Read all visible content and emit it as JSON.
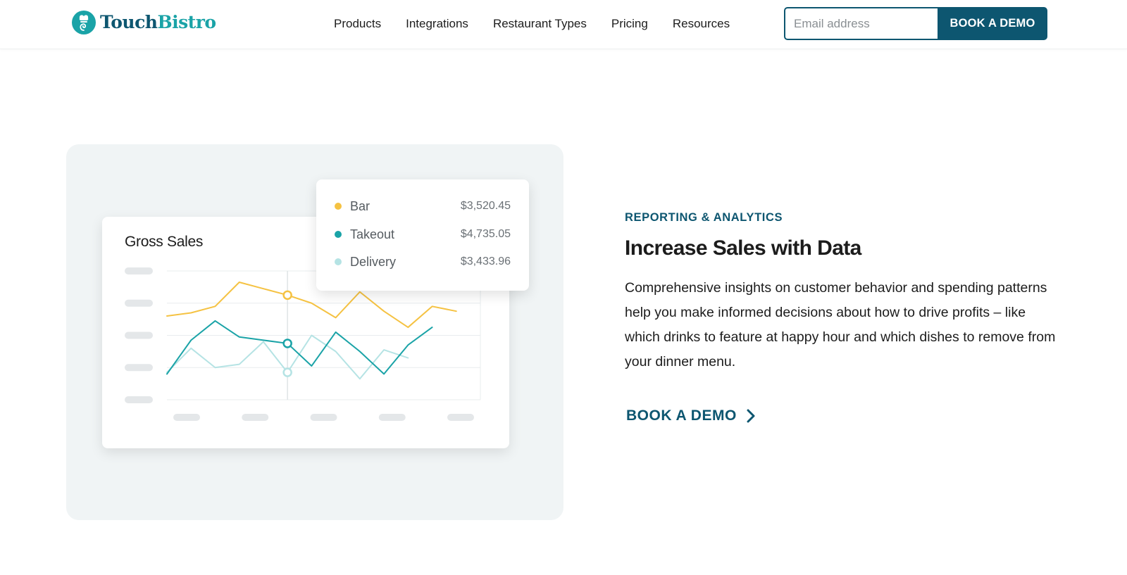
{
  "brand": {
    "name_part1": "Touch",
    "name_part2": "Bistro",
    "logo_icon": "chef-hat-swirl-icon",
    "color_primary": "#0d5670",
    "color_accent": "#1aa3a7"
  },
  "nav": {
    "items": [
      {
        "label": "Products"
      },
      {
        "label": "Integrations"
      },
      {
        "label": "Restaurant Types"
      },
      {
        "label": "Pricing"
      },
      {
        "label": "Resources"
      }
    ]
  },
  "header_cta": {
    "email_placeholder": "Email address",
    "email_value": "",
    "button_label": "BOOK A DEMO"
  },
  "illustration": {
    "chart_title": "Gross Sales",
    "legend": [
      {
        "name": "Bar",
        "value": "$3,520.45",
        "color": "#f5c242"
      },
      {
        "name": "Takeout",
        "value": "$4,735.05",
        "color": "#1aa3a7"
      },
      {
        "name": "Delivery",
        "value": "$3,433.96",
        "color": "#b5e3e4"
      }
    ]
  },
  "chart_data": {
    "type": "line",
    "title": "Gross Sales",
    "x": [
      0,
      1,
      2,
      3,
      4,
      5,
      6,
      7,
      8,
      9,
      10,
      11,
      12,
      13
    ],
    "series": [
      {
        "name": "Bar",
        "color": "#f5c242",
        "values": [
          52,
          54,
          58,
          73,
          69,
          65,
          60,
          51,
          67,
          55,
          45,
          58,
          55,
          null
        ]
      },
      {
        "name": "Takeout",
        "color": "#1aa3a7",
        "values": [
          16,
          37,
          49,
          39,
          37,
          35,
          21,
          42,
          30,
          16,
          34,
          45,
          null,
          null
        ]
      },
      {
        "name": "Delivery",
        "color": "#b5e3e4",
        "values": [
          17,
          32,
          20,
          22,
          36,
          17,
          40,
          30,
          13,
          31,
          26,
          null,
          null,
          null
        ]
      }
    ],
    "grid": true,
    "legend_position": "top-right"
  },
  "section": {
    "eyebrow": "REPORTING & ANALYTICS",
    "headline": "Increase Sales with Data",
    "body": "Comprehensive insights on customer behavior and spending patterns help you make informed decisions about how to drive profits – like which drinks to feature at happy hour and which dishes to remove from your dinner menu.",
    "cta_label": "BOOK A DEMO",
    "cta_icon": "chevron-right-icon"
  }
}
